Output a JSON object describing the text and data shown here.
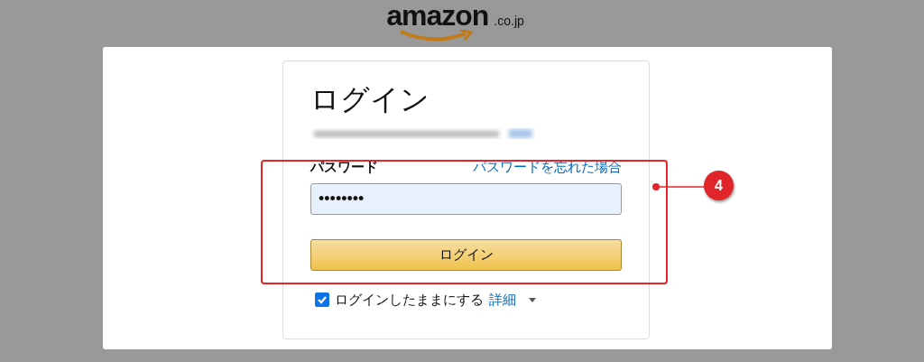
{
  "logo": {
    "wordmark": "amazon",
    "suffix": ".co.jp"
  },
  "signin": {
    "title": "ログイン",
    "email_blurred": true,
    "password_label": "パスワード",
    "forgot_link": "パスワードを忘れた場合",
    "password_value": "••••••••",
    "submit": "ログイン",
    "remember": {
      "label": "ログインしたままにする",
      "checked": true
    },
    "details_link": "詳細"
  },
  "annotation": {
    "number": "4"
  }
}
